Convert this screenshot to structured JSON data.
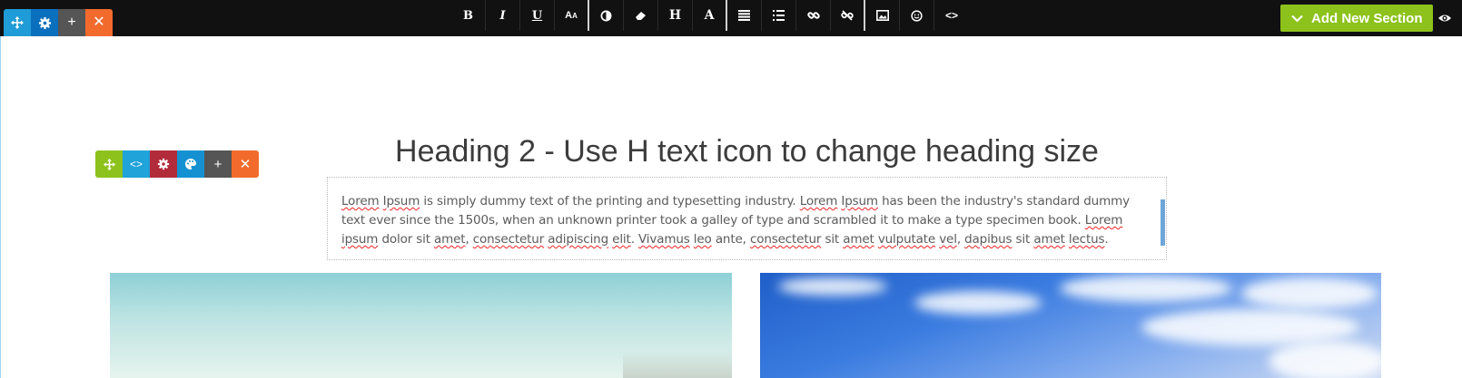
{
  "toolbar": {
    "format_buttons": [
      "bold",
      "italic",
      "underline",
      "font-size",
      "color-contrast",
      "eraser",
      "heading",
      "font",
      "align",
      "list",
      "link",
      "unlink",
      "image",
      "emoji",
      "code"
    ],
    "add_section_label": "Add New Section"
  },
  "content": {
    "heading": "Heading 2 - Use H text icon to change heading size",
    "paragraph_segments": [
      {
        "text": "Lorem",
        "spell": true
      },
      {
        "text": " ",
        "spell": false
      },
      {
        "text": "Ipsum",
        "spell": true
      },
      {
        "text": " is simply dummy text of the printing and typesetting industry. ",
        "spell": false
      },
      {
        "text": "Lorem",
        "spell": true
      },
      {
        "text": " ",
        "spell": false
      },
      {
        "text": "Ipsum",
        "spell": true
      },
      {
        "text": " has been the industry's standard dummy text ever since the 1500s, when an unknown printer took a galley of type and scrambled it to make a type specimen book. ",
        "spell": false
      },
      {
        "text": "Lorem",
        "spell": true
      },
      {
        "text": " ",
        "spell": false
      },
      {
        "text": "ipsum",
        "spell": true
      },
      {
        "text": " dolor sit ",
        "spell": false
      },
      {
        "text": "amet",
        "spell": true
      },
      {
        "text": ", ",
        "spell": false
      },
      {
        "text": "consectetur",
        "spell": true
      },
      {
        "text": " ",
        "spell": false
      },
      {
        "text": "adipiscing",
        "spell": true
      },
      {
        "text": " ",
        "spell": false
      },
      {
        "text": "elit",
        "spell": true
      },
      {
        "text": ". ",
        "spell": false
      },
      {
        "text": "Vivamus",
        "spell": true
      },
      {
        "text": " ",
        "spell": false
      },
      {
        "text": "leo",
        "spell": true
      },
      {
        "text": " ante, ",
        "spell": false
      },
      {
        "text": "consectetur",
        "spell": true
      },
      {
        "text": " sit ",
        "spell": false
      },
      {
        "text": "amet",
        "spell": true
      },
      {
        "text": " ",
        "spell": false
      },
      {
        "text": "vulputate",
        "spell": true
      },
      {
        "text": " ",
        "spell": false
      },
      {
        "text": "vel",
        "spell": true
      },
      {
        "text": ", ",
        "spell": false
      },
      {
        "text": "dapibus",
        "spell": true
      },
      {
        "text": " sit ",
        "spell": false
      },
      {
        "text": "amet",
        "spell": true
      },
      {
        "text": " ",
        "spell": false
      },
      {
        "text": "lectus",
        "spell": true
      },
      {
        "text": ".",
        "spell": false
      }
    ]
  },
  "colors": {
    "accent_green": "#8cc21b",
    "accent_blue": "#1f9bd7",
    "accent_orange": "#f26b2d",
    "toolbar_bg": "#111111"
  }
}
